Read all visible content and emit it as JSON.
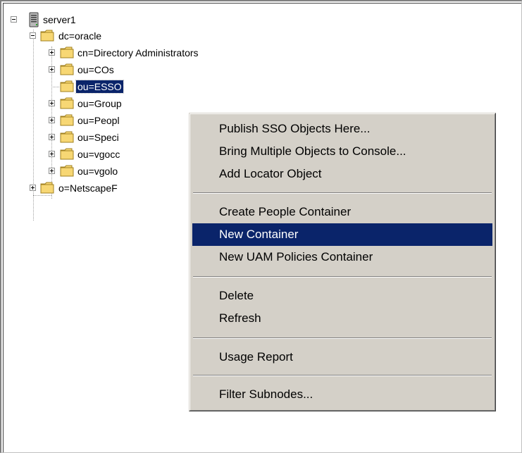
{
  "tree": {
    "root": {
      "label": "server1",
      "icon": "server-icon"
    },
    "dc": {
      "label": "dc=oracle"
    },
    "children": [
      {
        "label": "cn=Directory Administrators",
        "expandable": true
      },
      {
        "label": "ou=COs",
        "expandable": true
      },
      {
        "label": "ou=ESSO",
        "expandable": false,
        "selected": true
      },
      {
        "label": "ou=Group",
        "expandable": true
      },
      {
        "label": "ou=Peopl",
        "expandable": true
      },
      {
        "label": "ou=Speci",
        "expandable": true
      },
      {
        "label": "ou=vgocc",
        "expandable": true
      },
      {
        "label": "ou=vgolo",
        "expandable": true
      }
    ],
    "sibling": {
      "label": "o=NetscapeF"
    }
  },
  "context_menu": {
    "items": [
      {
        "label": "Publish SSO Objects Here..."
      },
      {
        "label": "Bring Multiple Objects to Console..."
      },
      {
        "label": "Add Locator Object"
      },
      {
        "label": "Create People Container"
      },
      {
        "label": "New Container",
        "highlighted": true
      },
      {
        "label": "New UAM Policies Container"
      },
      {
        "label": "Delete"
      },
      {
        "label": "Refresh"
      },
      {
        "label": "Usage Report"
      },
      {
        "label": "Filter Subnodes..."
      }
    ]
  },
  "colors": {
    "selection": "#0a246a",
    "menu_bg": "#d4d0c8",
    "folder": "#f7d774"
  }
}
